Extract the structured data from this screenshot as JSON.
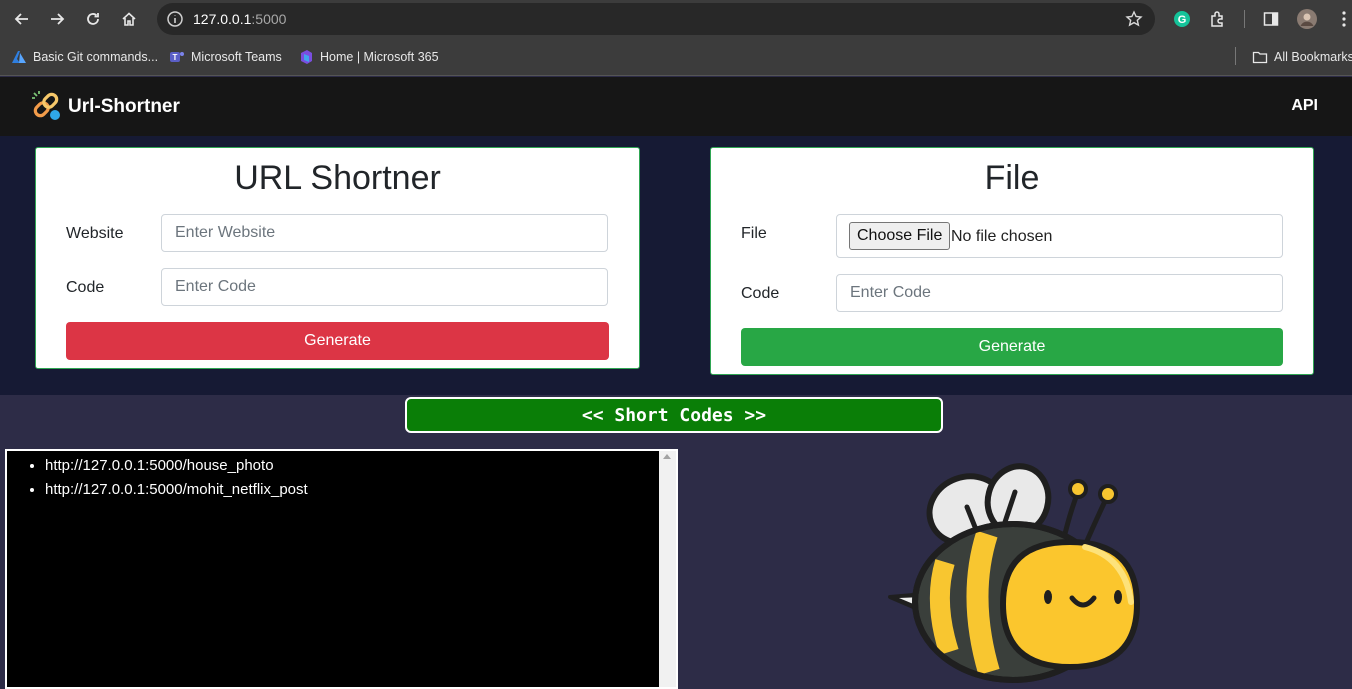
{
  "browser": {
    "url_host": "127.0.0.1",
    "url_port": ":5000",
    "bookmarks": [
      {
        "label": "Basic Git commands...",
        "icon": "azure-devops-icon"
      },
      {
        "label": "Microsoft Teams",
        "icon": "teams-icon"
      },
      {
        "label": "Home | Microsoft 365",
        "icon": "microsoft-365-icon"
      }
    ],
    "all_bookmarks": "All Bookmarks"
  },
  "navbar": {
    "brand": "Url-Shortner",
    "api": "API"
  },
  "url_card": {
    "title": "URL Shortner",
    "website_label": "Website",
    "website_placeholder": "Enter Website",
    "code_label": "Code",
    "code_placeholder": "Enter Code",
    "button": "Generate",
    "button_color": "#dc3545"
  },
  "file_card": {
    "title": "File",
    "file_label": "File",
    "choose_button": "Choose File",
    "no_file": "No file chosen",
    "code_label": "Code",
    "code_placeholder": "Enter Code",
    "button": "Generate",
    "button_color": "#28a745"
  },
  "short_codes": {
    "header": "<< Short Codes >>",
    "items": [
      "http://127.0.0.1:5000/house_photo",
      "http://127.0.0.1:5000/mohit_netflix_post"
    ]
  }
}
